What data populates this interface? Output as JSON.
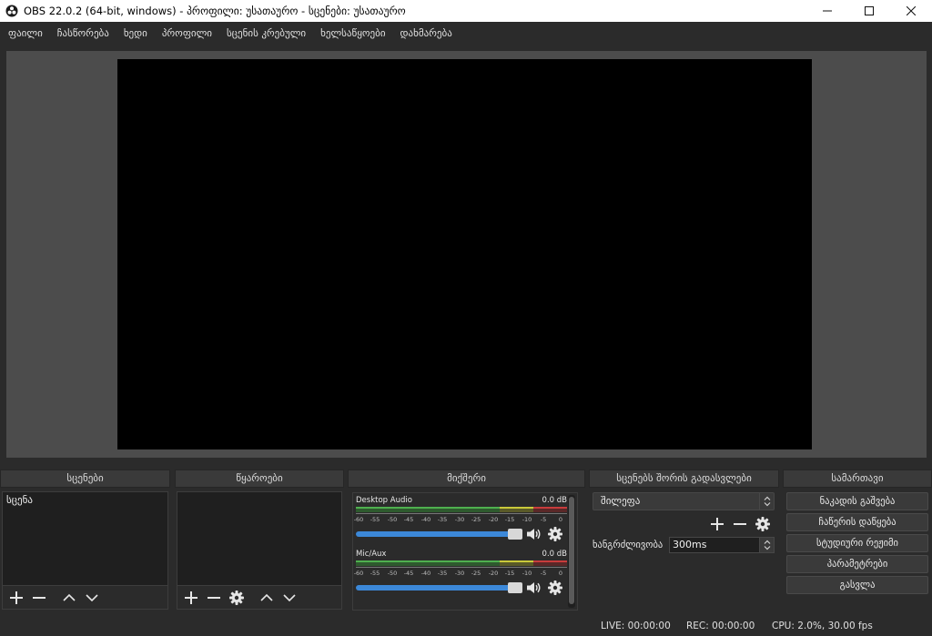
{
  "window": {
    "title": "OBS 22.0.2 (64-bit, windows) - პროფილი: უსათაურო - სცენები: უსათაურო",
    "app_icon": "obs-logo-icon",
    "controls": [
      "minimize-icon",
      "maximize-icon",
      "close-icon"
    ]
  },
  "menu": {
    "items": [
      "ფაილი",
      "ჩასწორება",
      "ხედი",
      "პროფილი",
      "სცენის კრებული",
      "ხელსაწყოები",
      "დახმარება"
    ]
  },
  "docks": {
    "scenes": {
      "title": "სცენები",
      "items": [
        "სცენა"
      ]
    },
    "sources": {
      "title": "წყაროები"
    },
    "mixer": {
      "title": "მიქშერი",
      "scale": [
        "-60",
        "-55",
        "-50",
        "-45",
        "-40",
        "-35",
        "-30",
        "-25",
        "-20",
        "-15",
        "-10",
        "-5",
        "0"
      ],
      "channels": [
        {
          "name": "Desktop Audio",
          "level": "0.0 dB",
          "volume_fraction": 1.0
        },
        {
          "name": "Mic/Aux",
          "level": "0.0 dB",
          "volume_fraction": 1.0
        }
      ]
    },
    "transitions": {
      "title": "სცენებს შორის გადასვლები",
      "selected": "შილეფა",
      "duration_label": "ხანგრძლივობა",
      "duration_value": "300ms"
    },
    "controls": {
      "title": "სამართავი",
      "buttons": [
        "ნაკადის გაშვება",
        "ჩაწერის დაწყება",
        "სტუდიური რეჟიმი",
        "პარამეტრები",
        "გასვლა"
      ]
    }
  },
  "status": {
    "live": "LIVE: 00:00:00",
    "rec": "REC: 00:00:00",
    "cpu": "CPU: 2.0%, 30.00 fps"
  },
  "colors": {
    "background": "#2b2b2b",
    "preview_bg": "#4c4c4c",
    "canvas": "#000000",
    "slider_fill": "#3c88d8"
  }
}
